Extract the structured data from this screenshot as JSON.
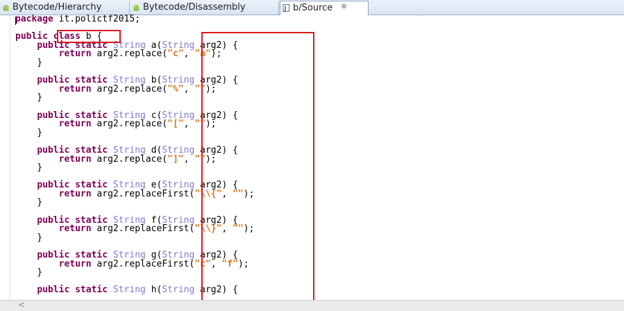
{
  "tabs": [
    {
      "label": "Bytecode/Hierarchy",
      "icon": "android-icon"
    },
    {
      "label": "Bytecode/Disassembly",
      "icon": "android-icon"
    },
    {
      "label": "b/Source",
      "icon": "java-source-icon",
      "close": "⊕"
    }
  ],
  "code_lines": [
    "package it.polictf2015;",
    "",
    "public class b {",
    "    public static String a(String arg2) {",
    "        return arg2.replace(\"c\", \"a\");",
    "    }",
    "",
    "    public static String b(String arg2) {",
    "        return arg2.replace(\"%\", \"\");",
    "    }",
    "",
    "    public static String c(String arg2) {",
    "        return arg2.replace(\"[\", \"\");",
    "    }",
    "",
    "    public static String d(String arg2) {",
    "        return arg2.replace(\"]\", \"\");",
    "    }",
    "",
    "    public static String e(String arg2) {",
    "        return arg2.replaceFirst(\"\\\\{\", \"\");",
    "    }",
    "",
    "    public static String f(String arg2) {",
    "        return arg2.replaceFirst(\"\\\\}\", \"\");",
    "    }",
    "",
    "    public static String g(String arg2) {",
    "        return arg2.replaceFirst(\"c\", \"f\");",
    "    }",
    "",
    "    public static String h(String arg2) {"
  ],
  "scrollbar": {
    "left_arrow": "<"
  },
  "colors": {
    "keyword": "#7f0055",
    "type": "#7b7bd6",
    "string": "#e2741b",
    "annotation_box": "#d9191f"
  }
}
